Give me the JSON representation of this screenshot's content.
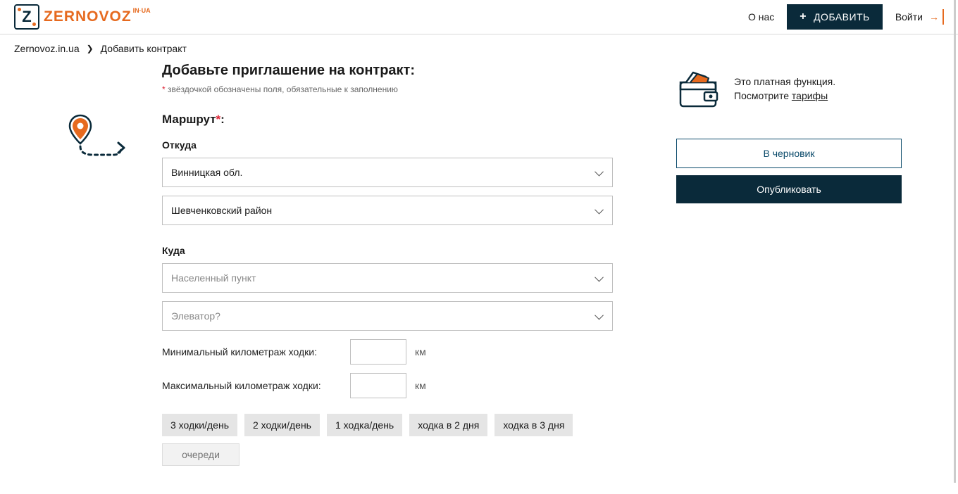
{
  "header": {
    "logo_brand": "ZERNOVOZ",
    "logo_sup": "IN·UA",
    "about": "О нас",
    "add": "ДОБАВИТЬ",
    "login": "Войти"
  },
  "breadcrumb": {
    "home": "Zernovoz.in.ua",
    "current": "Добавить контракт"
  },
  "page": {
    "title": "Добавьте приглашение на контракт:",
    "required_note": "звёздочкой обозначены поля, обязательные к заполнению"
  },
  "route": {
    "title": "Маршрут",
    "from_label": "Откуда",
    "from_region": "Винницкая обл.",
    "from_district": "Шевченковский район",
    "to_label": "Куда",
    "to_city_placeholder": "Населенный пункт",
    "to_elevator_placeholder": "Элеватор?",
    "min_km_label": "Минимальный километраж ходки:",
    "max_km_label": "Максимальный километраж ходки:",
    "km_unit": "км",
    "chips": [
      "3 ходки/день",
      "2 ходки/день",
      "1 ходка/день",
      "ходка в 2 дня",
      "ходка в 3 дня"
    ],
    "chip_input_placeholder": "очереди"
  },
  "side": {
    "paid_line1": "Это платная функция.",
    "paid_line2_prefix": "Посмотрите ",
    "paid_link": "тарифы",
    "draft": "В черновик",
    "publish": "Опубликовать"
  }
}
